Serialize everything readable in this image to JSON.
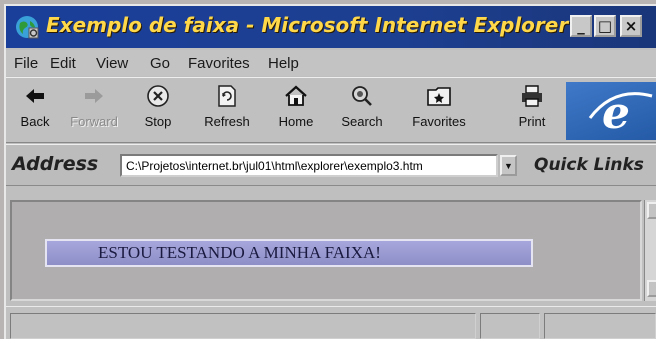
{
  "window": {
    "title": "Exemplo de faixa  - Microsoft Internet Explorer",
    "minimize_label": "_",
    "maximize_label": "□",
    "close_label": "×"
  },
  "menu": [
    {
      "label": "File"
    },
    {
      "label": "Edit"
    },
    {
      "label": "View"
    },
    {
      "label": "Go"
    },
    {
      "label": "Favorites"
    },
    {
      "label": "Help"
    }
  ],
  "toolbar": {
    "back": "Back",
    "forward": "Forward",
    "stop": "Stop",
    "refresh": "Refresh",
    "home": "Home",
    "search": "Search",
    "favorites": "Favorites",
    "print": "Print"
  },
  "address": {
    "label": "Address",
    "url": "C:\\Projetos\\internet.br\\jul01\\html\\explorer\\exemplo3.htm",
    "quick_links": "Quick Links"
  },
  "page": {
    "banner_text": "ESTOU TESTANDO A MINHA FAIXA!"
  },
  "colors": {
    "title_bar": "#1d3f90",
    "title_text": "#ffd84a",
    "banner_bg": "#9a9ad2"
  }
}
